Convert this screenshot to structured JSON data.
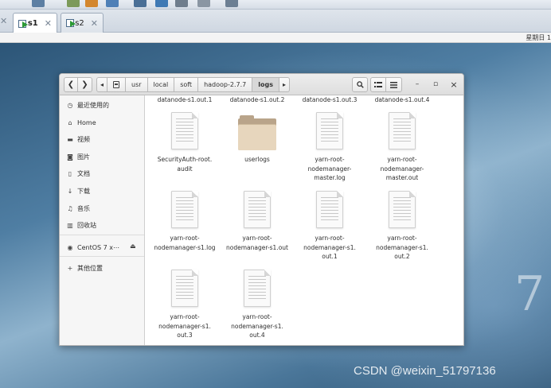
{
  "host": {
    "tabs": [
      {
        "label": "s1",
        "active": true
      },
      {
        "label": "s2",
        "active": false
      }
    ],
    "clock_text": "星期日 1"
  },
  "window": {
    "path": [
      "usr",
      "local",
      "soft",
      "hadoop-2.7.7",
      "logs"
    ],
    "controls": {
      "minimize": "–",
      "maximize": "▫",
      "close": "×"
    }
  },
  "sidebar": {
    "items": [
      {
        "icon": "clock-icon",
        "label": "最近使用的"
      },
      {
        "icon": "home-icon",
        "label": "Home"
      },
      {
        "icon": "video-icon",
        "label": "视频"
      },
      {
        "icon": "camera-icon",
        "label": "图片"
      },
      {
        "icon": "document-icon",
        "label": "文档"
      },
      {
        "icon": "download-icon",
        "label": "下载"
      },
      {
        "icon": "music-icon",
        "label": "音乐"
      },
      {
        "icon": "trash-icon",
        "label": "回收站"
      }
    ],
    "device": {
      "icon": "disc-icon",
      "label": "CentOS 7 x⋯"
    },
    "other": {
      "icon": "plus-icon",
      "label": "其他位置"
    }
  },
  "files": {
    "top_partial": [
      "datanode-s1.out.1",
      "datanode-s1.out.2",
      "datanode-s1.out.3",
      "datanode-s1.out.4"
    ],
    "items": [
      {
        "type": "doc",
        "name": "SecurityAuth-root.\naudit"
      },
      {
        "type": "folder",
        "name": "userlogs"
      },
      {
        "type": "doc",
        "name": "yarn-root-\nnodemanager-\nmaster.log"
      },
      {
        "type": "doc",
        "name": "yarn-root-\nnodemanager-\nmaster.out"
      },
      {
        "type": "doc",
        "name": "yarn-root-\nnodemanager-s1.log"
      },
      {
        "type": "doc",
        "name": "yarn-root-\nnodemanager-s1.out"
      },
      {
        "type": "doc",
        "name": "yarn-root-\nnodemanager-s1.\nout.1"
      },
      {
        "type": "doc",
        "name": "yarn-root-\nnodemanager-s1.\nout.2"
      },
      {
        "type": "doc",
        "name": "yarn-root-\nnodemanager-s1.\nout.3"
      },
      {
        "type": "doc",
        "name": "yarn-root-\nnodemanager-s1.\nout.4"
      }
    ]
  },
  "desktop": {
    "big_number": "7",
    "watermark": "CSDN @weixin_51797136"
  }
}
